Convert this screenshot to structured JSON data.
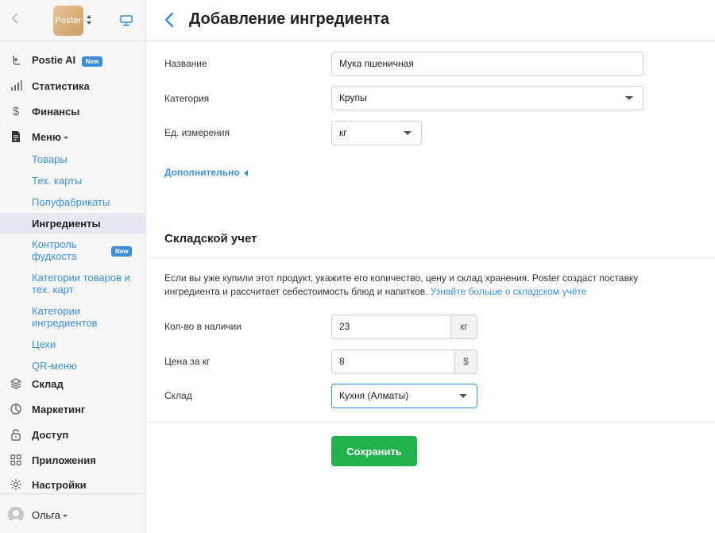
{
  "sidebar": {
    "logo_text": "Poster",
    "nav": {
      "ai": {
        "label": "Postie AI",
        "badge": "New"
      },
      "stats": {
        "label": "Статистика"
      },
      "finance": {
        "label": "Финансы"
      },
      "menu": {
        "label": "Меню"
      },
      "warehouse": {
        "label": "Склад"
      },
      "marketing": {
        "label": "Маркетинг"
      },
      "access": {
        "label": "Доступ"
      },
      "apps": {
        "label": "Приложения"
      },
      "settings": {
        "label": "Настройки"
      }
    },
    "menu_sub": {
      "goods": "Товары",
      "tech_cards": "Тех. карты",
      "semi": "Полуфабрикаты",
      "ingredients": "Ингредиенты",
      "foodcost": "Контроль фудкоста",
      "foodcost_badge": "New",
      "goods_categories": "Категории товаров и тех. карт",
      "ingredient_categories": "Категории ингредиентов",
      "workshops": "Цехи",
      "qr_menu": "QR-меню"
    },
    "user": {
      "name": "Ольга"
    }
  },
  "header": {
    "title": "Добавление ингредиента"
  },
  "form": {
    "name_label": "Название",
    "name_value": "Мука пшеничная",
    "category_label": "Категория",
    "category_value": "Крупы",
    "unit_label": "Ед. измерения",
    "unit_value": "кг",
    "more_link": "Дополнительно"
  },
  "stock": {
    "title": "Складской учет",
    "description": "Если вы уже купили этот продукт, укажите его количество, цену и склад хранения. Poster создаст поставку ингредиента и рассчитает себестоимость блюд и напитков.",
    "learn_more": "Узнайте больше о складском учёте",
    "qty_label": "Кол-во в наличии",
    "qty_value": "23",
    "qty_unit": "кг",
    "price_label": "Цена за кг",
    "price_value": "8",
    "price_currency": "$",
    "warehouse_label": "Склад",
    "warehouse_value": "Кухня (Алматы)"
  },
  "actions": {
    "save_label": "Сохранить"
  },
  "colors": {
    "accent": "#3b8fd9",
    "save": "#21b24d",
    "active_bg": "#e5e9ef"
  }
}
